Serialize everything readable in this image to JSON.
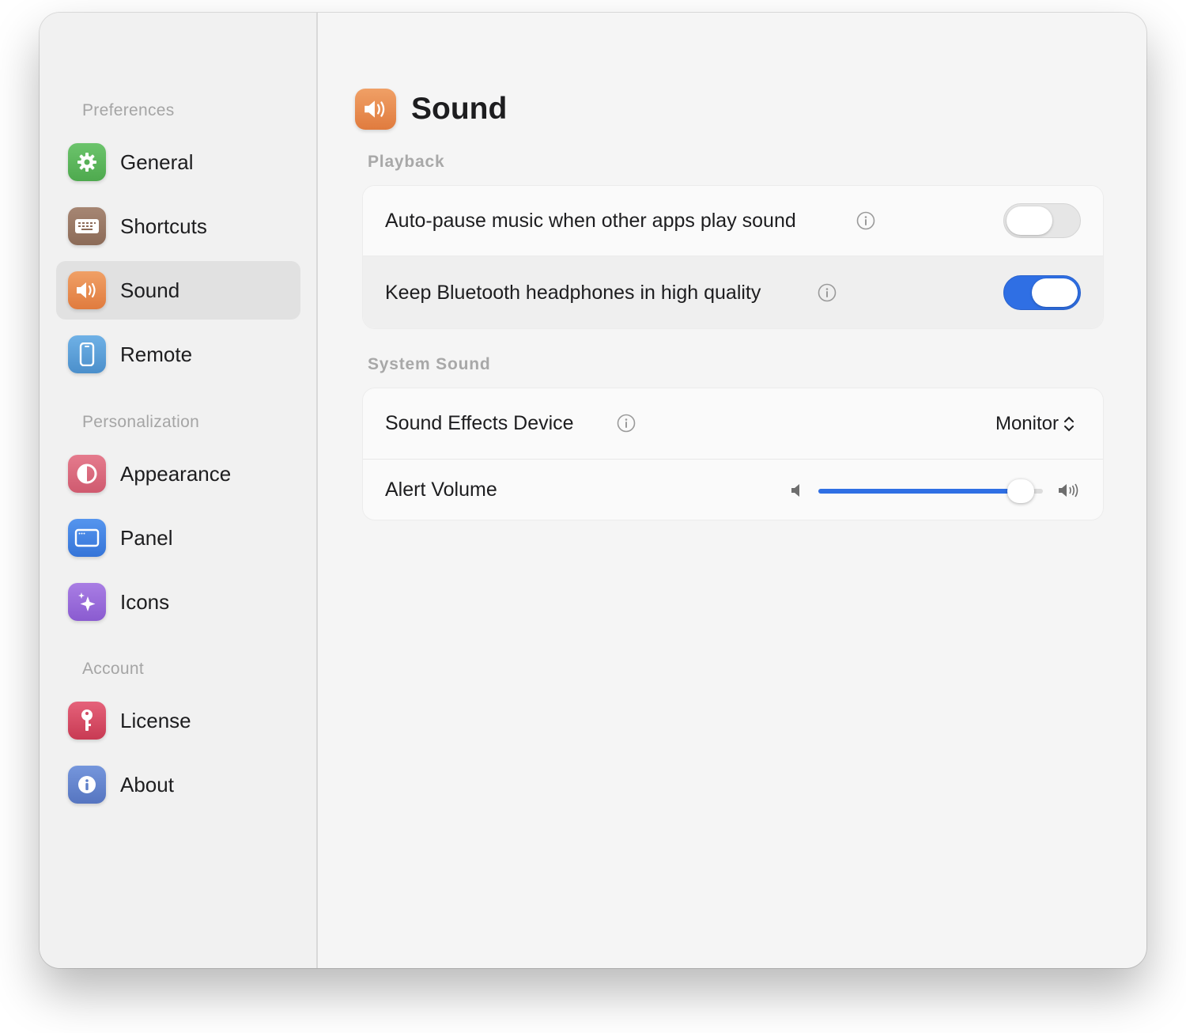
{
  "sidebar": {
    "sections": [
      {
        "title": "Preferences",
        "items": [
          {
            "label": "General",
            "icon": "gear-icon",
            "color": "#5cb85c"
          },
          {
            "label": "Shortcuts",
            "icon": "keyboard-icon",
            "color": "#9a7a66"
          },
          {
            "label": "Sound",
            "icon": "speaker-icon",
            "color": "#e8894d",
            "active": true
          },
          {
            "label": "Remote",
            "icon": "phone-icon",
            "color": "#5aa0d8"
          }
        ]
      },
      {
        "title": "Personalization",
        "items": [
          {
            "label": "Appearance",
            "icon": "half-circle-icon",
            "color": "#d9667a"
          },
          {
            "label": "Panel",
            "icon": "window-icon",
            "color": "#3f82e6"
          },
          {
            "label": "Icons",
            "icon": "sparkle-icon",
            "color": "#9a6ad8"
          }
        ]
      },
      {
        "title": "Account",
        "items": [
          {
            "label": "License",
            "icon": "key-icon",
            "color": "#d9475f"
          },
          {
            "label": "About",
            "icon": "info-icon",
            "color": "#5d7fc9"
          }
        ]
      }
    ]
  },
  "page": {
    "title": "Sound",
    "icon": "speaker-icon",
    "playback": {
      "title": "Playback",
      "auto_pause": {
        "label": "Auto-pause music when other apps play sound",
        "enabled": false
      },
      "bluetooth": {
        "label": "Keep Bluetooth headphones in high quality",
        "enabled": true
      }
    },
    "system_sound": {
      "title": "System Sound",
      "effects_device": {
        "label": "Sound Effects Device",
        "value": "Monitor"
      },
      "alert_volume": {
        "label": "Alert Volume",
        "level": 0.9
      }
    },
    "accent_color": "#2f6fe4"
  }
}
